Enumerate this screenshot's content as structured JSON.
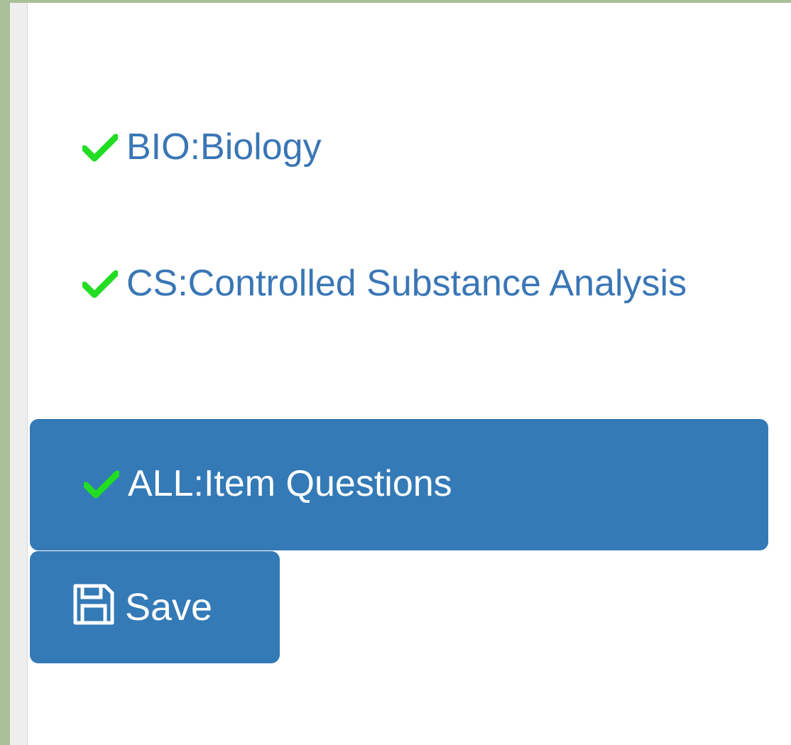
{
  "items": [
    {
      "code": "BIO",
      "label": "BIO:Biology",
      "checked": true,
      "selected": false
    },
    {
      "code": "CS",
      "label": "CS:Controlled Substance Analysis",
      "checked": true,
      "selected": false
    },
    {
      "code": "ALL",
      "label": "ALL:Item Questions",
      "checked": true,
      "selected": true
    }
  ],
  "save": {
    "label": "Save",
    "icon": "floppy-disk-icon"
  },
  "colors": {
    "check": "#22dd22",
    "link": "#3a76b5",
    "selected_bg": "#337ab7",
    "frame": "#a9bf98"
  }
}
